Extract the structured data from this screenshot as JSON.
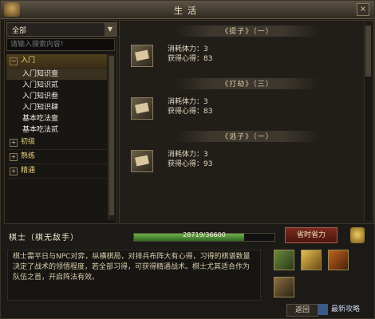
{
  "window": {
    "title": "生活",
    "close_label": "×"
  },
  "left_panel": {
    "dropdown_value": "全部",
    "search_placeholder": "请输入搜索内容!",
    "categories": [
      {
        "label": "入门",
        "expanded": true,
        "expander": "−",
        "items": [
          "入门知识壹",
          "入门知识贰",
          "入门知识叁",
          "入门知识肆",
          "基本吃法壹",
          "基本吃法贰"
        ]
      },
      {
        "label": "初级",
        "expanded": false,
        "expander": "+"
      },
      {
        "label": "熟练",
        "expanded": false,
        "expander": "+"
      },
      {
        "label": "精通",
        "expanded": false,
        "expander": "+"
      }
    ]
  },
  "entries": [
    {
      "banner": "《提子》（一）",
      "stamina_label": "消耗体力：",
      "stamina": "3",
      "gain_label": "获得心得：",
      "gain": "83"
    },
    {
      "banner": "《打劫》（三）",
      "stamina_label": "消耗体力：",
      "stamina": "3",
      "gain_label": "获得心得：",
      "gain": "83"
    },
    {
      "banner": "《逃子》（一）",
      "stamina_label": "消耗体力：",
      "stamina": "3",
      "gain_label": "获得心得：",
      "gain": "93"
    }
  ],
  "bottom": {
    "rank": "棋士（棋无敌手）",
    "progress_text": "28719/36600",
    "progress_fraction": 0.785,
    "save_button": "省时省力",
    "description": "棋士需平日与NPC对弈，纵横棋局，对排兵布阵大有心得，习得的棋谱数量决定了战术的领悟程度，若全部习得，可获得精通战术。棋士尤其适合作为队伍之首，开启阵法有效。",
    "return_button": "返回",
    "return_extra": "最新攻略"
  },
  "icons": [
    "gear-icon",
    "chevron-down-icon",
    "close-icon",
    "book-icon",
    "cup-icon"
  ],
  "colors": {
    "category": "#e5cf78",
    "progress": "#4f8e34",
    "save_button": "#6a2418"
  }
}
